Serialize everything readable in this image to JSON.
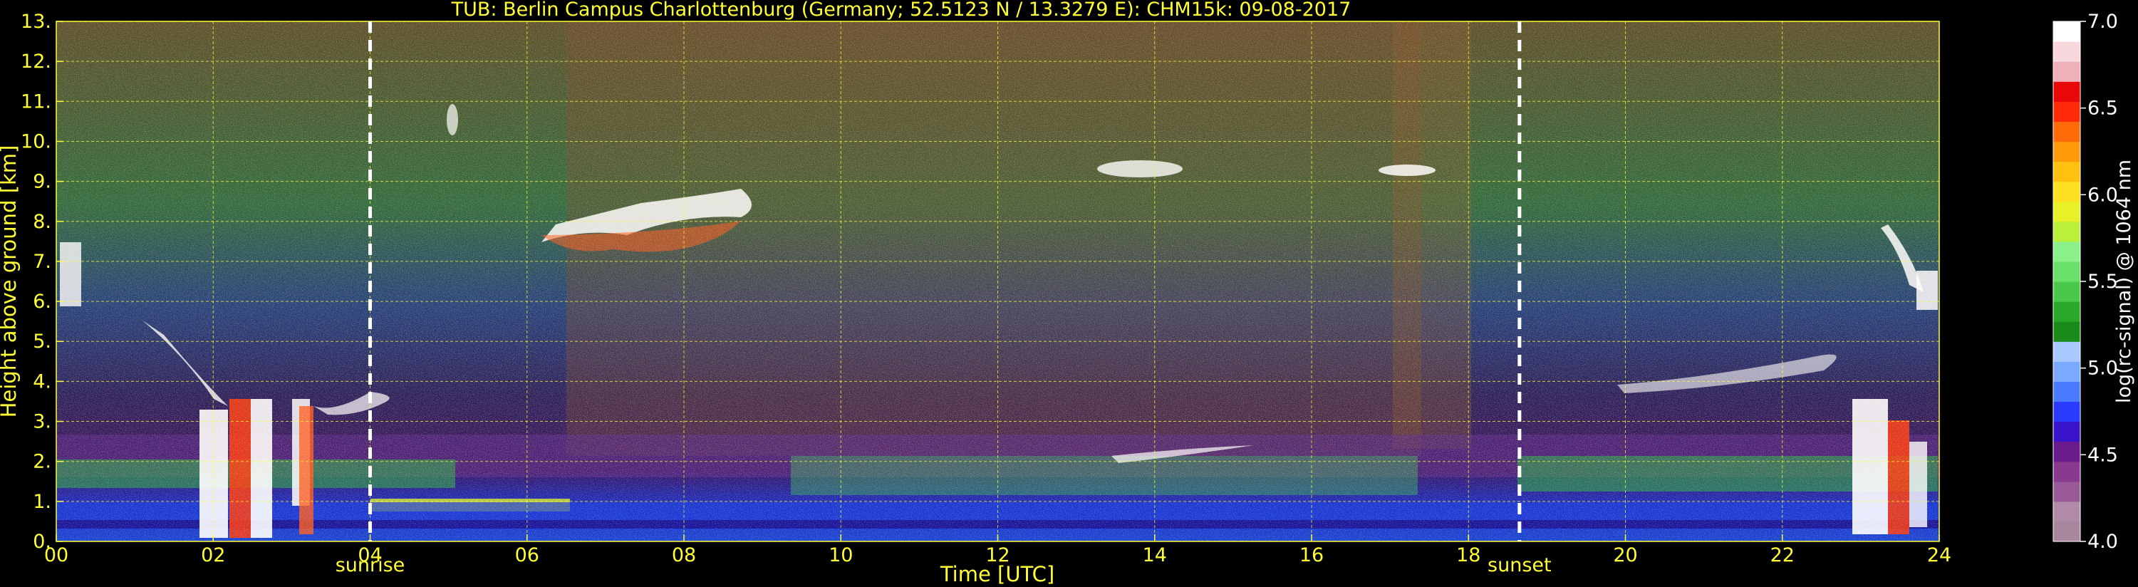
{
  "chart_data": {
    "type": "heatmap",
    "title": "TUB: Berlin Campus Charlottenburg (Germany; 52.5123 N / 13.3279 E):    CHM15k: 09-08-2017",
    "xlabel": "Time [UTC]",
    "ylabel": "Height above ground [km]",
    "xlim": [
      0,
      24
    ],
    "ylim": [
      0,
      13
    ],
    "x_ticks": [
      0,
      2,
      4,
      6,
      8,
      10,
      12,
      14,
      16,
      18,
      20,
      22,
      24
    ],
    "x_tick_labels": [
      "00",
      "02",
      "04",
      "06",
      "08",
      "10",
      "12",
      "14",
      "16",
      "18",
      "20",
      "22",
      "24"
    ],
    "y_ticks": [
      0,
      1,
      2,
      3,
      4,
      5,
      6,
      7,
      8,
      9,
      10,
      11,
      12,
      13
    ],
    "y_tick_labels": [
      "0.",
      "1.",
      "2.",
      "3.",
      "4.",
      "5.",
      "6.",
      "7.",
      "8.",
      "9.",
      "10.",
      "11.",
      "12.",
      "13."
    ],
    "grid": true,
    "annotations": [
      {
        "text": "sunrise",
        "x": 4.0
      },
      {
        "text": "sunset",
        "x": 18.65
      }
    ],
    "colorbar": {
      "label": "log(rc-signal) @ 1064 nm",
      "range": [
        4.0,
        7.0
      ],
      "ticks": [
        4.0,
        4.5,
        5.0,
        5.5,
        6.0,
        6.5,
        7.0
      ],
      "tick_labels": [
        "4.0",
        "4.5",
        "5.0",
        "5.5",
        "6.0",
        "6.5",
        "7.0"
      ],
      "colors": [
        "#a8869e",
        "#b08aa6",
        "#9a5a9a",
        "#8a3a8e",
        "#6a1a8a",
        "#3a14c8",
        "#2a3aff",
        "#4a7aff",
        "#7aaaff",
        "#a8c8ff",
        "#1a8a1a",
        "#2aa82a",
        "#4ac84a",
        "#6ae06a",
        "#8af08a",
        "#b8f03a",
        "#e8f028",
        "#ffe020",
        "#ffc010",
        "#ff9a08",
        "#ff6a08",
        "#ff2a08",
        "#e80808",
        "#f0b0b8",
        "#f8d8dc",
        "#ffffff"
      ]
    },
    "features": [
      {
        "name": "aerosol layer (PBL)",
        "x_range": [
          0,
          24
        ],
        "height_km": [
          0,
          1.9
        ]
      },
      {
        "name": "cirrus cloud",
        "x_range": [
          6.6,
          8.8
        ],
        "height_km": [
          6.7,
          8.2
        ]
      },
      {
        "name": "cirrus cloud",
        "x_range": [
          13.3,
          14.9
        ],
        "height_km": [
          9.2,
          9.8
        ]
      },
      {
        "name": "cirrus cloud",
        "x_range": [
          16.9,
          17.7
        ],
        "height_km": [
          9.3,
          9.5
        ]
      },
      {
        "name": "boundary layer cloud",
        "x_range": [
          1.7,
          3.3
        ],
        "height_km": [
          0.1,
          4.0
        ]
      },
      {
        "name": "boundary layer cloud",
        "x_range": [
          22.8,
          23.9
        ],
        "height_km": [
          0.3,
          4.6
        ]
      }
    ]
  }
}
